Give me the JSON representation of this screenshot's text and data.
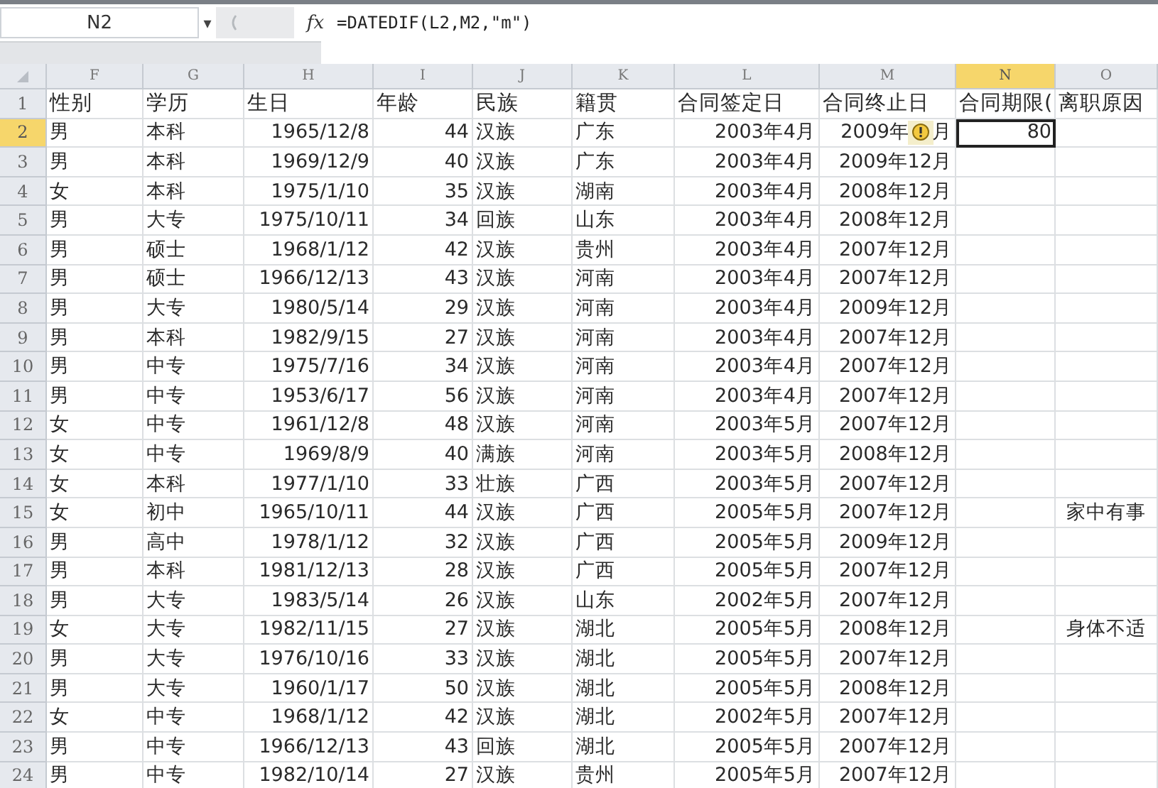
{
  "formula_bar": {
    "name_box": "N2",
    "dropdown": "▾",
    "fx_label": "fx",
    "formula": "=DATEDIF(L2,M2,\"m\")"
  },
  "columns": [
    {
      "label": "F",
      "selected": false
    },
    {
      "label": "G",
      "selected": false
    },
    {
      "label": "H",
      "selected": false
    },
    {
      "label": "I",
      "selected": false
    },
    {
      "label": "J",
      "selected": false
    },
    {
      "label": "K",
      "selected": false
    },
    {
      "label": "L",
      "selected": false
    },
    {
      "label": "M",
      "selected": false
    },
    {
      "label": "N",
      "selected": true
    },
    {
      "label": "O",
      "selected": false
    }
  ],
  "rows": [
    {
      "number": "1",
      "kind": "header",
      "selected": false,
      "gender": "性别",
      "education": "学历",
      "birthday": "生日",
      "age": "年龄",
      "ethnicity": "民族",
      "origin": "籍贯",
      "sign_date": "合同签定日",
      "end_date": "合同终止日",
      "term": "合同期限(",
      "reason": "离职原因"
    },
    {
      "number": "2",
      "kind": "data",
      "selected": true,
      "gender": "男",
      "education": "本科",
      "birthday": "1965/12/8",
      "age": "44",
      "ethnicity": "汉族",
      "origin": "广东",
      "sign_date": "2003年4月",
      "end_date": "2009年",
      "smart_tag": true,
      "end_date_tail": "月",
      "term": "80"
    },
    {
      "number": "3",
      "kind": "data",
      "selected": false,
      "gender": "男",
      "education": "本科",
      "birthday": "1969/12/9",
      "age": "40",
      "ethnicity": "汉族",
      "origin": "广东",
      "sign_date": "2003年4月",
      "end_date": "2009年12月"
    },
    {
      "number": "4",
      "kind": "data",
      "selected": false,
      "gender": "女",
      "education": "本科",
      "birthday": "1975/1/10",
      "age": "35",
      "ethnicity": "汉族",
      "origin": "湖南",
      "sign_date": "2003年4月",
      "end_date": "2008年12月"
    },
    {
      "number": "5",
      "kind": "data",
      "selected": false,
      "gender": "男",
      "education": "大专",
      "birthday": "1975/10/11",
      "age": "34",
      "ethnicity": "回族",
      "origin": "山东",
      "sign_date": "2003年4月",
      "end_date": "2008年12月"
    },
    {
      "number": "6",
      "kind": "data",
      "selected": false,
      "gender": "男",
      "education": "硕士",
      "birthday": "1968/1/12",
      "age": "42",
      "ethnicity": "汉族",
      "origin": "贵州",
      "sign_date": "2003年4月",
      "end_date": "2007年12月"
    },
    {
      "number": "7",
      "kind": "data",
      "selected": false,
      "gender": "男",
      "education": "硕士",
      "birthday": "1966/12/13",
      "age": "43",
      "ethnicity": "汉族",
      "origin": "河南",
      "sign_date": "2003年4月",
      "end_date": "2007年12月"
    },
    {
      "number": "8",
      "kind": "data",
      "selected": false,
      "gender": "男",
      "education": "大专",
      "birthday": "1980/5/14",
      "age": "29",
      "ethnicity": "汉族",
      "origin": "河南",
      "sign_date": "2003年4月",
      "end_date": "2009年12月"
    },
    {
      "number": "9",
      "kind": "data",
      "selected": false,
      "gender": "男",
      "education": "本科",
      "birthday": "1982/9/15",
      "age": "27",
      "ethnicity": "汉族",
      "origin": "河南",
      "sign_date": "2003年4月",
      "end_date": "2007年12月"
    },
    {
      "number": "10",
      "kind": "data",
      "selected": false,
      "gender": "男",
      "education": "中专",
      "birthday": "1975/7/16",
      "age": "34",
      "ethnicity": "汉族",
      "origin": "河南",
      "sign_date": "2003年4月",
      "end_date": "2007年12月"
    },
    {
      "number": "11",
      "kind": "data",
      "selected": false,
      "gender": "男",
      "education": "中专",
      "birthday": "1953/6/17",
      "age": "56",
      "ethnicity": "汉族",
      "origin": "河南",
      "sign_date": "2003年4月",
      "end_date": "2007年12月"
    },
    {
      "number": "12",
      "kind": "data",
      "selected": false,
      "gender": "女",
      "education": "中专",
      "birthday": "1961/12/8",
      "age": "48",
      "ethnicity": "汉族",
      "origin": "河南",
      "sign_date": "2003年5月",
      "end_date": "2007年12月"
    },
    {
      "number": "13",
      "kind": "data",
      "selected": false,
      "gender": "女",
      "education": "中专",
      "birthday": "1969/8/9",
      "age": "40",
      "ethnicity": "满族",
      "origin": "河南",
      "sign_date": "2003年5月",
      "end_date": "2008年12月"
    },
    {
      "number": "14",
      "kind": "data",
      "selected": false,
      "gender": "女",
      "education": "本科",
      "birthday": "1977/1/10",
      "age": "33",
      "ethnicity": "壮族",
      "origin": "广西",
      "sign_date": "2003年5月",
      "end_date": "2007年12月"
    },
    {
      "number": "15",
      "kind": "data",
      "selected": false,
      "gender": "女",
      "education": "初中",
      "birthday": "1965/10/11",
      "age": "44",
      "ethnicity": "汉族",
      "origin": "广西",
      "sign_date": "2005年5月",
      "end_date": "2007年12月",
      "reason": "家中有事"
    },
    {
      "number": "16",
      "kind": "data",
      "selected": false,
      "gender": "男",
      "education": "高中",
      "birthday": "1978/1/12",
      "age": "32",
      "ethnicity": "汉族",
      "origin": "广西",
      "sign_date": "2005年5月",
      "end_date": "2009年12月"
    },
    {
      "number": "17",
      "kind": "data",
      "selected": false,
      "gender": "男",
      "education": "本科",
      "birthday": "1981/12/13",
      "age": "28",
      "ethnicity": "汉族",
      "origin": "广西",
      "sign_date": "2005年5月",
      "end_date": "2007年12月"
    },
    {
      "number": "18",
      "kind": "data",
      "selected": false,
      "gender": "男",
      "education": "大专",
      "birthday": "1983/5/14",
      "age": "26",
      "ethnicity": "汉族",
      "origin": "山东",
      "sign_date": "2002年5月",
      "end_date": "2007年12月"
    },
    {
      "number": "19",
      "kind": "data",
      "selected": false,
      "gender": "女",
      "education": "大专",
      "birthday": "1982/11/15",
      "age": "27",
      "ethnicity": "汉族",
      "origin": "湖北",
      "sign_date": "2005年5月",
      "end_date": "2008年12月",
      "reason": "身体不适"
    },
    {
      "number": "20",
      "kind": "data",
      "selected": false,
      "gender": "男",
      "education": "大专",
      "birthday": "1976/10/16",
      "age": "33",
      "ethnicity": "汉族",
      "origin": "湖北",
      "sign_date": "2005年5月",
      "end_date": "2007年12月"
    },
    {
      "number": "21",
      "kind": "data",
      "selected": false,
      "gender": "男",
      "education": "大专",
      "birthday": "1960/1/17",
      "age": "50",
      "ethnicity": "汉族",
      "origin": "湖北",
      "sign_date": "2005年5月",
      "end_date": "2008年12月"
    },
    {
      "number": "22",
      "kind": "data",
      "selected": false,
      "gender": "女",
      "education": "中专",
      "birthday": "1968/1/12",
      "age": "42",
      "ethnicity": "汉族",
      "origin": "湖北",
      "sign_date": "2002年5月",
      "end_date": "2007年12月"
    },
    {
      "number": "23",
      "kind": "data",
      "selected": false,
      "gender": "男",
      "education": "中专",
      "birthday": "1966/12/13",
      "age": "43",
      "ethnicity": "回族",
      "origin": "湖北",
      "sign_date": "2005年5月",
      "end_date": "2007年12月"
    },
    {
      "number": "24",
      "kind": "data",
      "selected": false,
      "gender": "男",
      "education": "中专",
      "birthday": "1982/10/14",
      "age": "27",
      "ethnicity": "汉族",
      "origin": "贵州",
      "sign_date": "2005年5月",
      "end_date": "2007年12月"
    }
  ]
}
